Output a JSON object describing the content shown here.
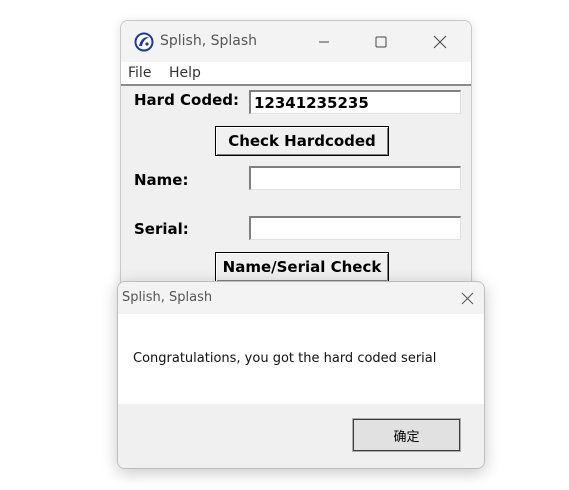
{
  "main_window": {
    "title": "Splish, Splash",
    "icon": "splash-app-icon",
    "controls": {
      "minimize": "minimize-icon",
      "maximize": "maximize-icon",
      "close": "close-icon"
    }
  },
  "menu": {
    "items": [
      {
        "label": "File"
      },
      {
        "label": "Help"
      }
    ]
  },
  "form": {
    "hardcoded_label": "Hard Coded:",
    "hardcoded_value": "12341235235",
    "check_hardcoded_label": "Check Hardcoded",
    "name_label": "Name:",
    "name_value": "",
    "serial_label": "Serial:",
    "serial_value": "",
    "check_name_serial_label": "Name/Serial Check"
  },
  "dialog": {
    "title": "Splish, Splash",
    "message": "Congratulations, you got the hard coded serial",
    "ok_label": "确定",
    "close": "close-icon"
  }
}
